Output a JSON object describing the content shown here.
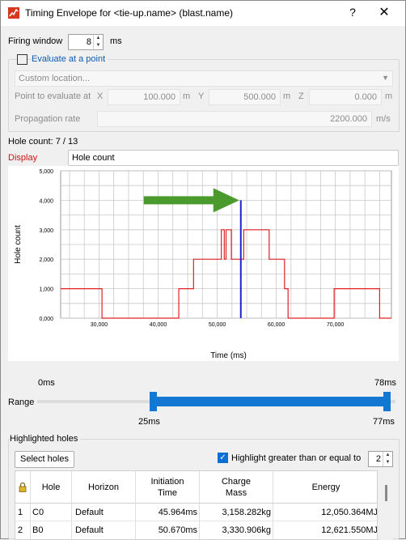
{
  "titlebar": {
    "title": "Timing Envelope for <tie-up.name> (blast.name)",
    "help_label": "?",
    "close_label": "✕"
  },
  "firing_window": {
    "label": "Firing window",
    "value": "8",
    "unit": "ms"
  },
  "evaluate_point": {
    "checkbox_label": "Evaluate at a point",
    "checked": false,
    "custom_location_placeholder": "Custom location...",
    "point_label": "Point to evaluate at",
    "x_label": "X",
    "x_value": "100.000",
    "x_unit": "m",
    "y_label": "Y",
    "y_value": "500.000",
    "y_unit": "m",
    "z_label": "Z",
    "z_value": "0.000",
    "z_unit": "m",
    "propagation_label": "Propagation rate",
    "propagation_value": "2200.000",
    "propagation_unit": "m/s"
  },
  "hole_count_label": "Hole count: 7 / 13",
  "display": {
    "label": "Display",
    "value": "Hole count"
  },
  "chart_data": {
    "type": "line",
    "xlabel": "Time (ms)",
    "ylabel": "Hole count",
    "xlim": [
      23.5,
      79.5
    ],
    "ylim": [
      0,
      5
    ],
    "x_ticks": [
      "30,000",
      "40,000",
      "50,000",
      "60,000",
      "70,000"
    ],
    "x_tick_values": [
      30,
      40,
      50,
      60,
      70
    ],
    "y_ticks": [
      "0,000",
      "1,000",
      "2,000",
      "3,000",
      "4,000",
      "5,000"
    ],
    "y_tick_values": [
      0,
      1,
      2,
      3,
      4,
      5
    ],
    "grid": true,
    "series": [
      {
        "color": "#e02020",
        "x": [
          23.5,
          30.5,
          30.5,
          43.5,
          43.5,
          46,
          46,
          50.7,
          50.7,
          51.2,
          51.2,
          51.5,
          51.5,
          52.4,
          52.4,
          54.5,
          54.5,
          58.8,
          58.8,
          61.4,
          61.4,
          62,
          62,
          69.8,
          69.8,
          77.5,
          77.5,
          79.5
        ],
        "y": [
          1,
          1,
          0,
          0,
          1,
          1,
          2,
          2,
          3,
          3,
          2,
          2,
          3,
          3,
          2,
          2,
          3,
          3,
          2,
          2,
          1,
          1,
          0,
          0,
          1,
          1,
          0,
          0
        ]
      }
    ],
    "markers": [
      {
        "name": "current-time",
        "color": "#2020d0",
        "x": 54,
        "y": 4
      }
    ],
    "arrow_color": "#4a9a2e"
  },
  "range": {
    "label": "Range",
    "min_label": "0ms",
    "max_label": "78ms",
    "low_label": "25ms",
    "high_label": "77ms",
    "min": 0,
    "max": 78,
    "low": 25,
    "high": 77,
    "accent": "#1278d4"
  },
  "highlighted": {
    "group_label": "Highlighted holes",
    "select_button": "Select holes",
    "highlight_label": "Highlight greater than or equal to",
    "highlight_checked": true,
    "threshold": "2"
  },
  "table": {
    "headers": [
      "",
      "Hole",
      "Horizon",
      "Initiation\nTime",
      "Charge\nMass",
      "Energy"
    ],
    "rows": [
      [
        "1",
        "C0",
        "Default",
        "45.964ms",
        "3,158.282kg",
        "12,050.364MJ"
      ],
      [
        "2",
        "B0",
        "Default",
        "50.670ms",
        "3,330.906kg",
        "12,621.550MJ"
      ]
    ]
  }
}
